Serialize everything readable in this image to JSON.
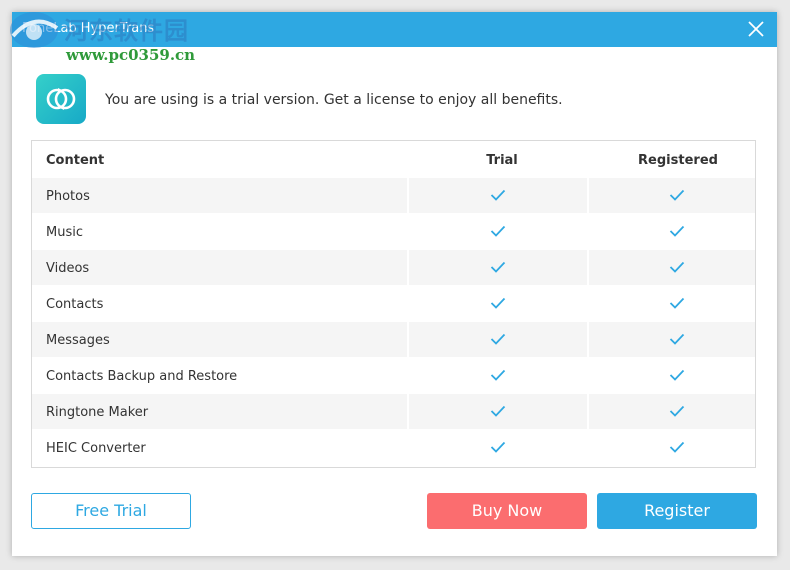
{
  "window": {
    "title": "FoneLab HyperTrans"
  },
  "watermark": {
    "cn_text": "河东软件园",
    "url": "www.pc0359.cn"
  },
  "notice": "You are using is a trial version. Get a license to enjoy all benefits.",
  "table": {
    "headers": {
      "content": "Content",
      "trial": "Trial",
      "registered": "Registered"
    },
    "rows": [
      {
        "name": "Photos",
        "trial": true,
        "registered": true
      },
      {
        "name": "Music",
        "trial": true,
        "registered": true
      },
      {
        "name": "Videos",
        "trial": true,
        "registered": true
      },
      {
        "name": "Contacts",
        "trial": true,
        "registered": true
      },
      {
        "name": "Messages",
        "trial": true,
        "registered": true
      },
      {
        "name": "Contacts Backup and Restore",
        "trial": true,
        "registered": true
      },
      {
        "name": "Ringtone Maker",
        "trial": true,
        "registered": true
      },
      {
        "name": "HEIC Converter",
        "trial": true,
        "registered": true
      }
    ]
  },
  "buttons": {
    "free_trial": "Free Trial",
    "buy_now": "Buy Now",
    "register": "Register"
  },
  "colors": {
    "accent": "#2ea8e2",
    "buy": "#fb6d6f",
    "check": "#2ea8e2"
  },
  "icons": {
    "close": "close-icon",
    "app": "sync-icon",
    "check": "checkmark-icon"
  }
}
